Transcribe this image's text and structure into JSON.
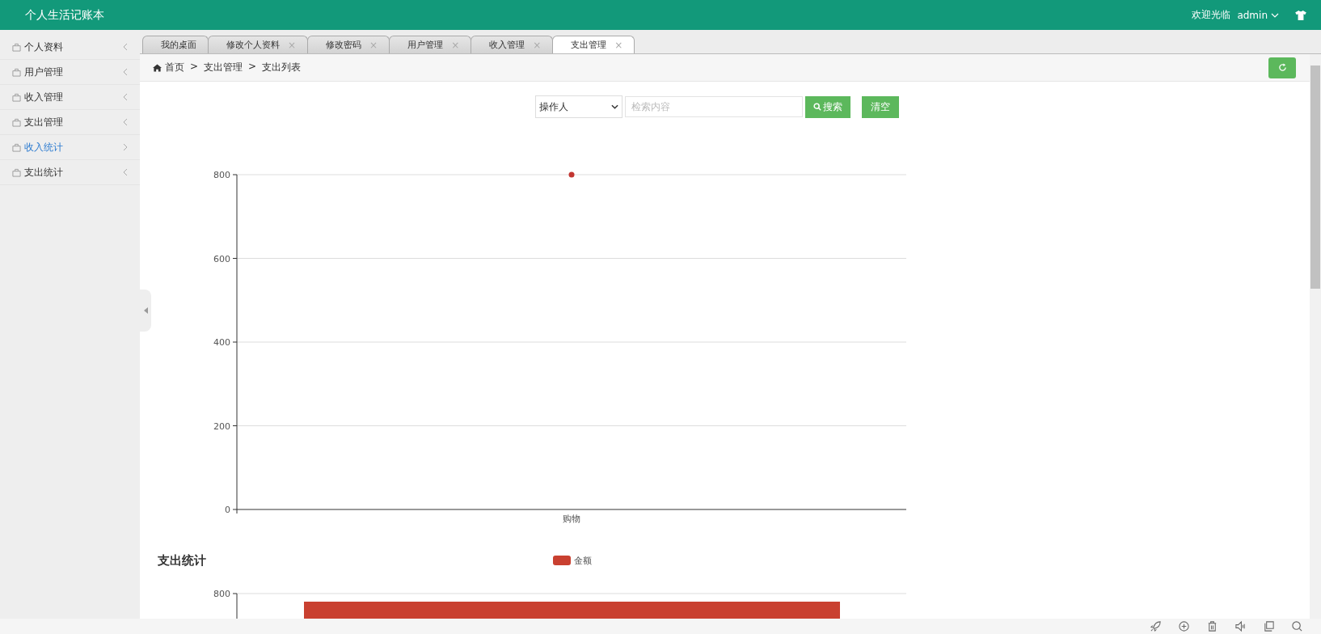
{
  "header": {
    "title": "个人生活记账本",
    "welcome": "欢迎光临",
    "user": "admin"
  },
  "sidebar": {
    "items": [
      {
        "label": "个人资料",
        "selected": false
      },
      {
        "label": "用户管理",
        "selected": false
      },
      {
        "label": "收入管理",
        "selected": false
      },
      {
        "label": "支出管理",
        "selected": false
      },
      {
        "label": "收入统计",
        "selected": true
      },
      {
        "label": "支出统计",
        "selected": false
      }
    ]
  },
  "tabs": [
    {
      "label": "我的桌面",
      "closable": false,
      "selected": false
    },
    {
      "label": "修改个人资料",
      "closable": true,
      "selected": false
    },
    {
      "label": "修改密码",
      "closable": true,
      "selected": false
    },
    {
      "label": "用户管理",
      "closable": true,
      "selected": false
    },
    {
      "label": "收入管理",
      "closable": true,
      "selected": false
    },
    {
      "label": "支出管理",
      "closable": true,
      "selected": true
    }
  ],
  "tab_close": "×",
  "breadcrumb": [
    "首页",
    "支出管理",
    "支出列表"
  ],
  "breadcrumb_separator": ">",
  "search": {
    "field": "操作人",
    "placeholder": "检索内容",
    "search_button": "搜索",
    "clear_button": "清空"
  },
  "chart": {
    "chart_data": {
      "type": "line",
      "categories": [
        "购物"
      ],
      "series": [
        {
          "color": "#c23531",
          "marker": true,
          "values": [
            800
          ]
        }
      ],
      "ylim": [
        0,
        800
      ],
      "yticks": [
        0,
        200,
        400,
        600,
        800
      ],
      "grid": true
    }
  },
  "expense_chart": {
    "title": "支出统计",
    "legend": {
      "label": "金额",
      "color": "#c94030"
    },
    "tick_label": "800"
  }
}
